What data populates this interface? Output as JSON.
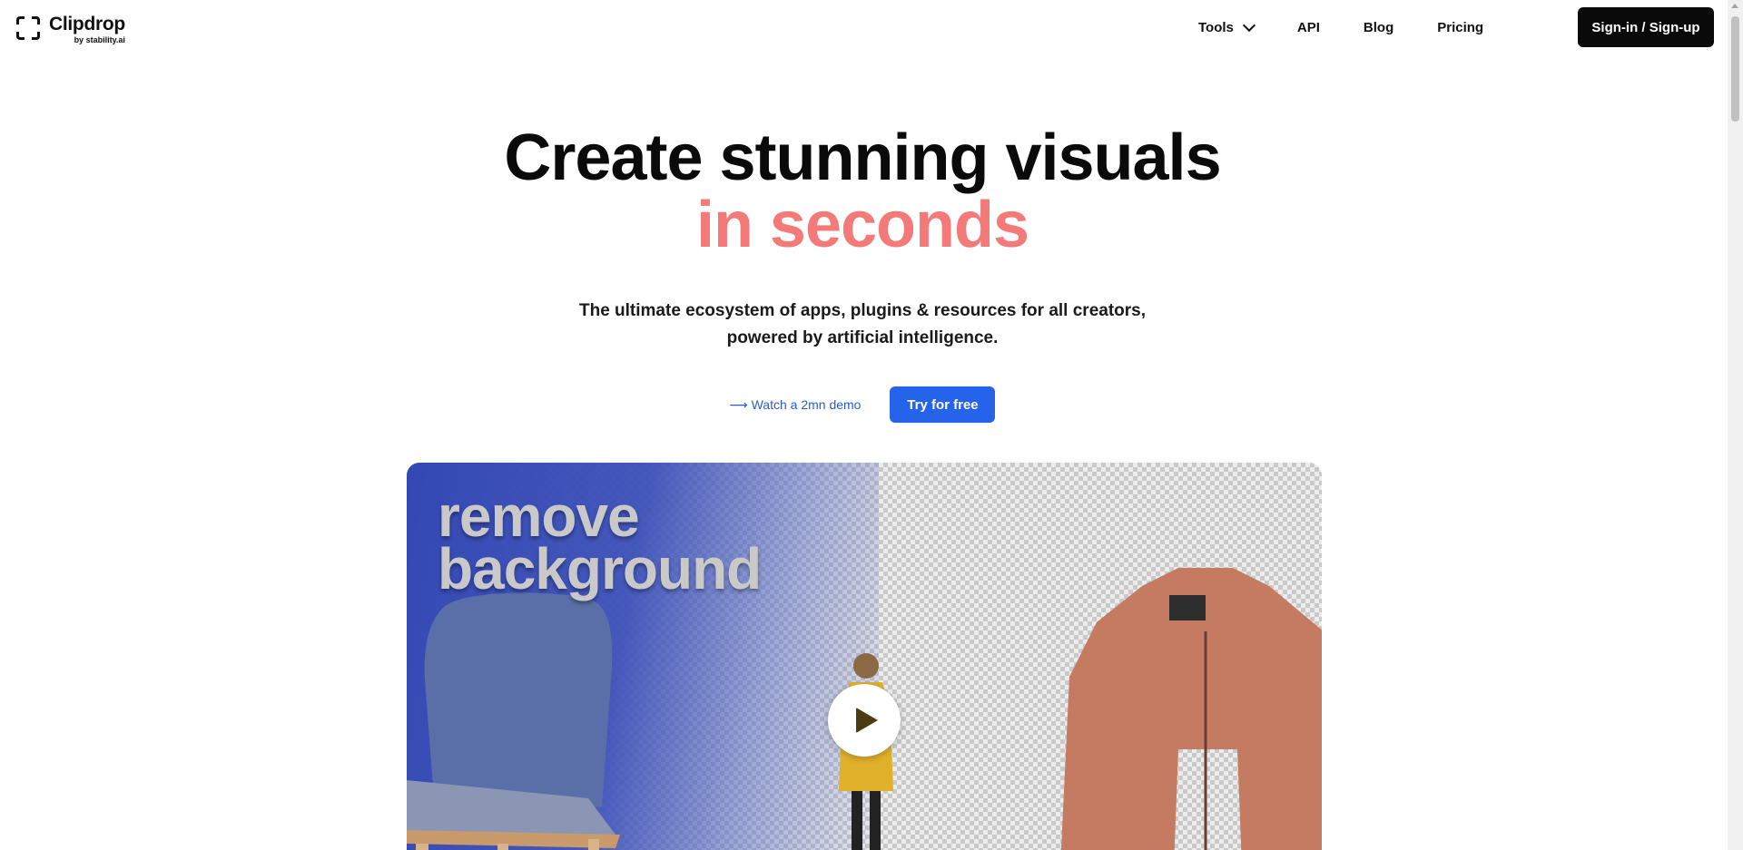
{
  "header": {
    "logo_name": "Clipdrop",
    "logo_sub": "by stability.ai",
    "nav": [
      {
        "label": "Tools",
        "icon": "chevron-down-icon"
      },
      {
        "label": "API"
      },
      {
        "label": "Blog"
      },
      {
        "label": "Pricing"
      }
    ],
    "signin_label": "Sign-in / Sign-up"
  },
  "hero": {
    "title_line1": "Create stunning visuals",
    "title_line2": "in seconds",
    "subtitle_line1": "The ultimate ecosystem of apps, plugins & resources for all creators,",
    "subtitle_line2": "powered by artificial intelligence.",
    "demo_arrow": "⟶",
    "demo_label": "Watch a 2mn demo",
    "try_label": "Try for free"
  },
  "video": {
    "caption_line1": "remove",
    "caption_line2": "background",
    "play_icon": "play-icon"
  },
  "colors": {
    "accent_pink": "#f47a7a",
    "primary_blue": "#2563eb",
    "link_blue": "#2a5bd7",
    "dark": "#0a0a0a"
  }
}
